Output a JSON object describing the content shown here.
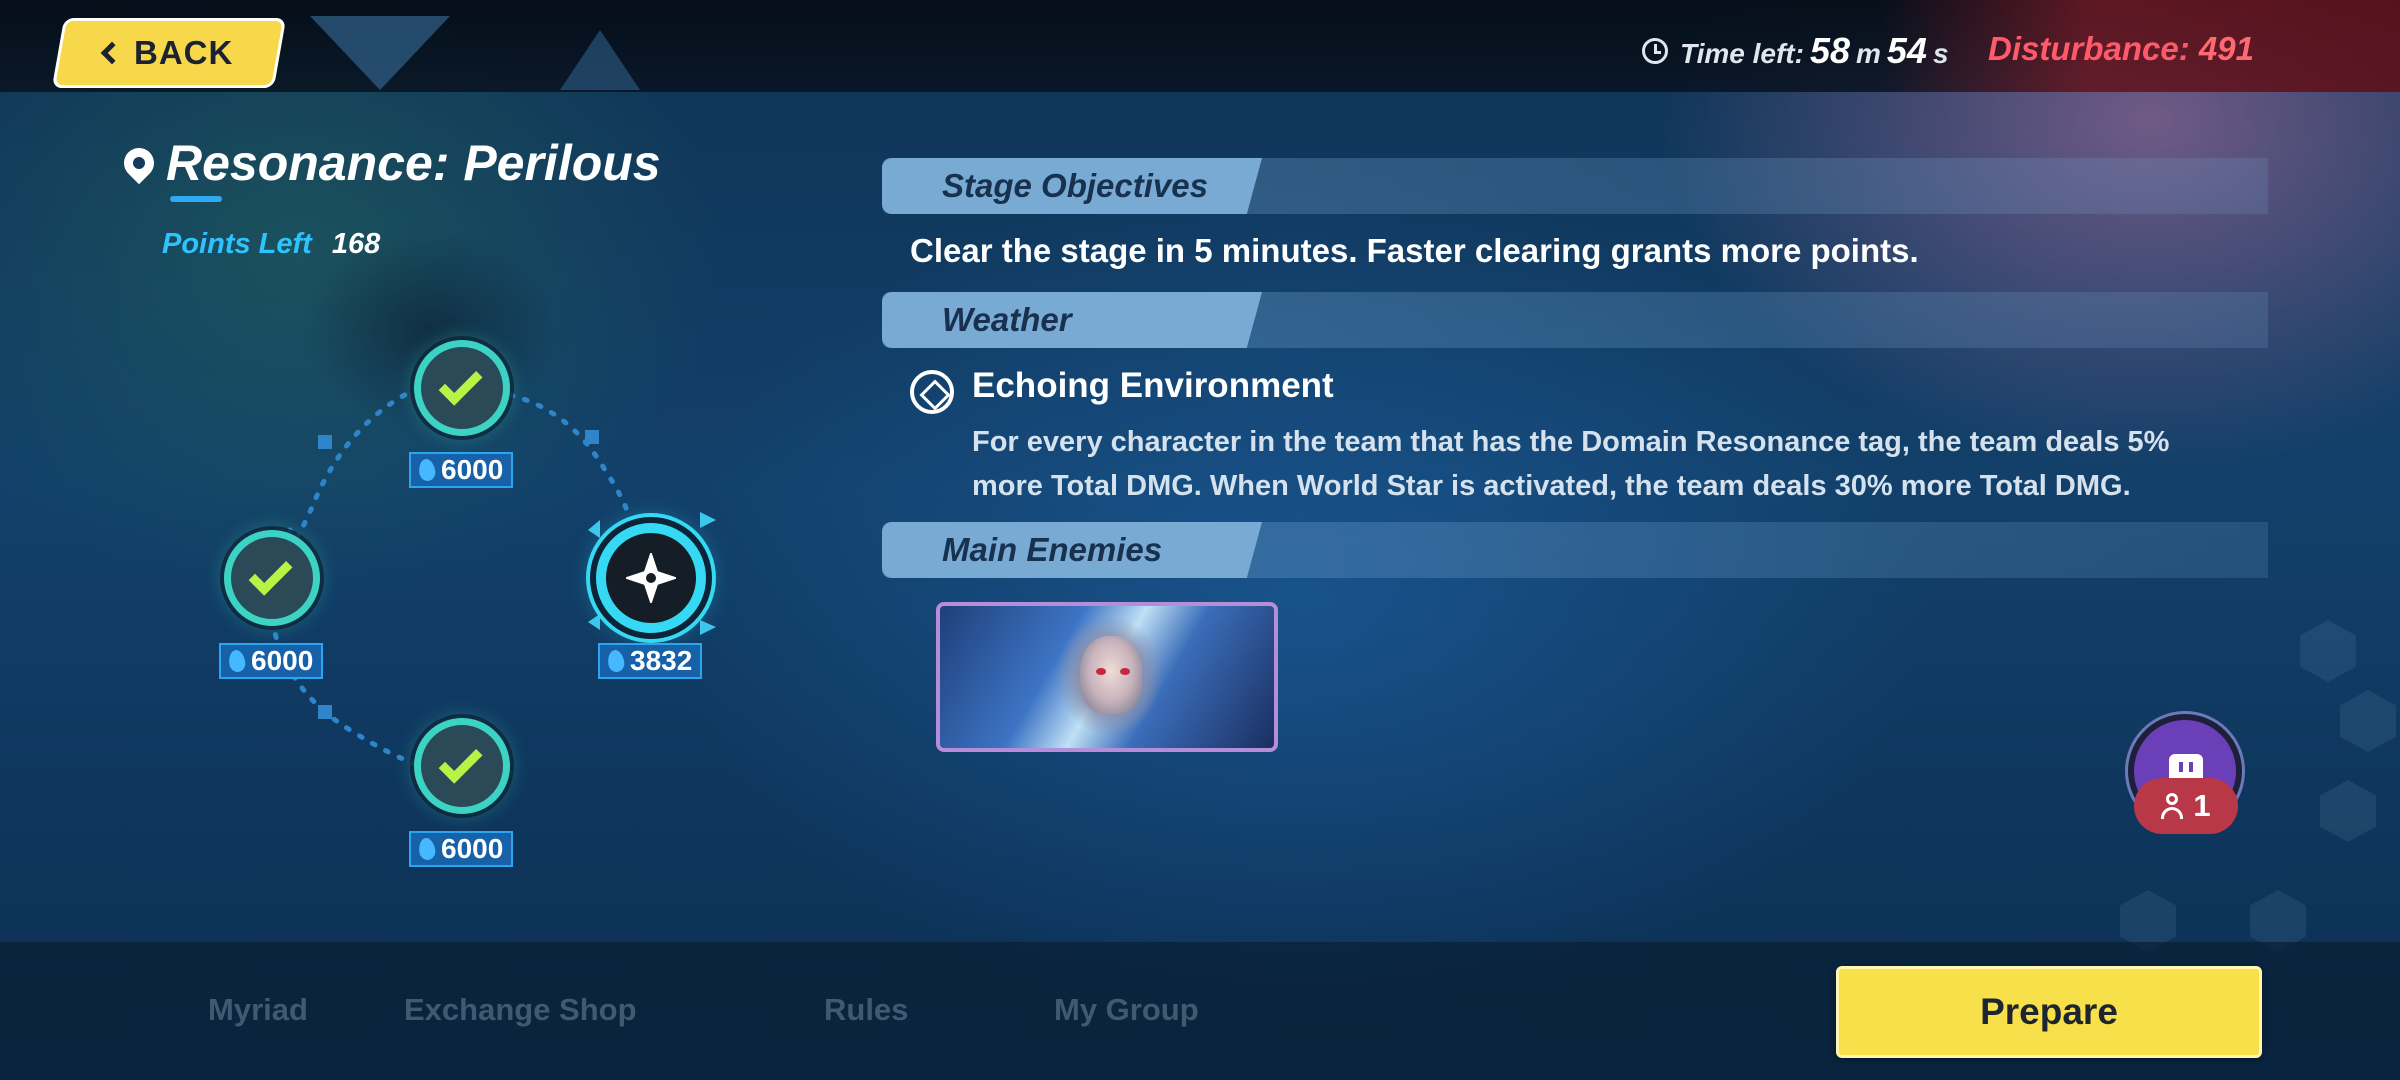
{
  "header": {
    "back_label": "BACK",
    "time_left_label": "Time left:",
    "minutes": "58",
    "minutes_unit": "m",
    "seconds": "54",
    "seconds_unit": "s",
    "disturbance_label": "Disturbance:",
    "disturbance_value": "491"
  },
  "stage": {
    "title": "Resonance: Perilous",
    "points_left_label": "Points Left",
    "points_left_value": "168"
  },
  "map_nodes": [
    {
      "status": "cleared",
      "score": "6000"
    },
    {
      "status": "cleared",
      "score": "6000"
    },
    {
      "status": "current",
      "score": "3832"
    },
    {
      "status": "cleared",
      "score": "6000"
    }
  ],
  "objectives": {
    "heading": "Stage Objectives",
    "text_before": "Clear the stage in ",
    "text_num": "5",
    "text_after": " minutes. Faster clearing grants more points."
  },
  "weather": {
    "heading": "Weather",
    "name": "Echoing Environment",
    "desc_line1": "For every character in the team that has the Domain Resonance tag, the team deals 5%",
    "desc_line2": "more Total DMG. When World Star is activated, the team deals 30% more Total DMG."
  },
  "enemies": {
    "heading": "Main Enemies"
  },
  "friends": {
    "count": "1"
  },
  "bottom_nav": {
    "tab1": "Myriad",
    "tab2": "Exchange Shop",
    "tab3": "Rules",
    "tab4": "My Group"
  },
  "prepare_label": "Prepare",
  "colors": {
    "accent_yellow": "#f6d84a",
    "node_teal": "#3dd3c4",
    "check_green": "#b8f245",
    "disturbance_red": "#ff5a6a",
    "section_tab": "#78aad3"
  }
}
